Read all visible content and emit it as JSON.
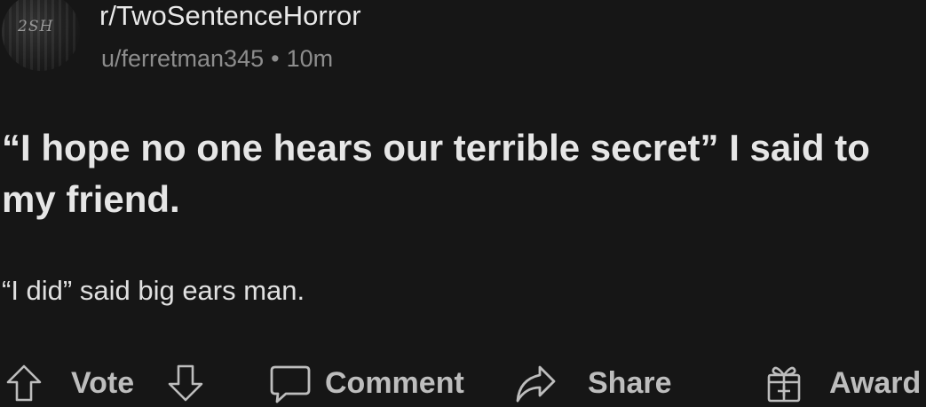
{
  "post": {
    "subreddit": "r/TwoSentenceHorror",
    "author": "u/ferretman345",
    "separator": "•",
    "age": "10m",
    "avatar_text": "2SH",
    "title": "“I hope no one hears our terrible secret” I said to my friend.",
    "body": "“I did” said big ears man."
  },
  "actions": {
    "upvote_icon": "arrow-up-icon",
    "vote_label": "Vote",
    "downvote_icon": "arrow-down-icon",
    "comment_icon": "comment-bubble-icon",
    "comment_label": "Comment",
    "share_icon": "share-arrow-icon",
    "share_label": "Share",
    "award_icon": "gift-icon",
    "award_label": "Award"
  },
  "colors": {
    "background": "#161616",
    "primary_text": "#e6e6e6",
    "secondary_text": "#8d8d8d",
    "action_text": "#bdbdbd"
  }
}
